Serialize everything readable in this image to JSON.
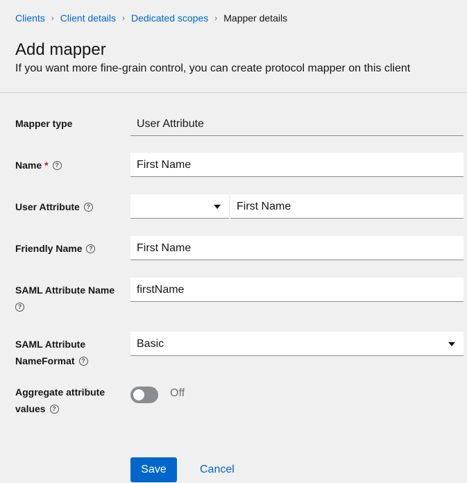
{
  "breadcrumb": {
    "items": [
      "Clients",
      "Client details",
      "Dedicated scopes"
    ],
    "current": "Mapper details",
    "separator": "›"
  },
  "header": {
    "title": "Add mapper",
    "subtitle": "If you want more fine-grain control, you can create protocol mapper on this client"
  },
  "form": {
    "mapper_type": {
      "label": "Mapper type",
      "value": "User Attribute"
    },
    "name": {
      "label": "Name",
      "required_mark": "*",
      "value": "First Name"
    },
    "user_attribute": {
      "label": "User Attribute",
      "select_value": "",
      "value": "First Name"
    },
    "friendly_name": {
      "label": "Friendly Name",
      "value": "First Name"
    },
    "saml_attribute_name": {
      "label": "SAML Attribute Name",
      "value": "firstName"
    },
    "saml_nameformat": {
      "label_line1": "SAML Attribute",
      "label_line2": "NameFormat",
      "value": "Basic"
    },
    "aggregate": {
      "label_line1": "Aggregate attribute",
      "label_line2": "values",
      "state": "Off",
      "enabled": false
    },
    "help_glyph": "?"
  },
  "actions": {
    "save_label": "Save",
    "cancel_label": "Cancel"
  }
}
